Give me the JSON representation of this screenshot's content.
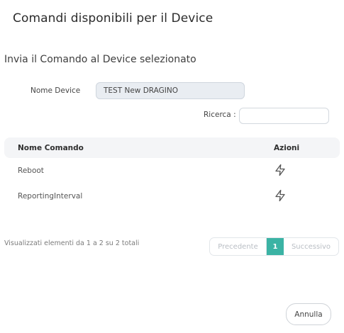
{
  "modal": {
    "title": "Comandi disponibili per il Device",
    "subtitle": "Invia il Comando al Device selezionato"
  },
  "device": {
    "label": "Nome Device",
    "value": "TEST New DRAGINO"
  },
  "search": {
    "label": "Ricerca :",
    "value": ""
  },
  "table": {
    "columns": [
      "Nome Comando",
      "Azioni"
    ],
    "rows": [
      {
        "name": "Reboot",
        "action_icon": "lightning-icon"
      },
      {
        "name": "ReportingInterval",
        "action_icon": "lightning-icon"
      }
    ]
  },
  "pagination": {
    "info": "Visualizzati elementi da 1 a 2 su 2 totali",
    "previous": "Precedente",
    "current_page": "1",
    "next": "Successivo",
    "active_color": "#3bb3a4"
  },
  "footer": {
    "cancel_label": "Annulla"
  }
}
